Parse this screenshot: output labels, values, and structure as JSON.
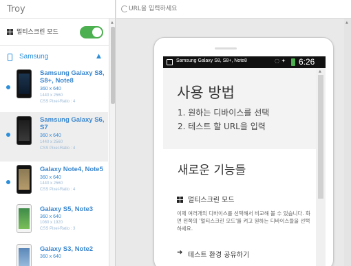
{
  "app": {
    "title": "Troy"
  },
  "multiscreen": {
    "label": "멀티스크린 모드",
    "enabled": true
  },
  "group": {
    "label": "Samsung",
    "expanded": true
  },
  "devices": [
    {
      "name": "Samsung Galaxy S8, S8+, Note8",
      "resolution": "360 x 640",
      "physical": "1440 x 2560",
      "ratio": "CSS Pixel-Ratio : 4",
      "dot": true,
      "selected": false
    },
    {
      "name": "Samsung Galaxy S6, S7",
      "resolution": "360 x 640",
      "physical": "1440 x 2560",
      "ratio": "CSS Pixel-Ratio : 4",
      "dot": true,
      "selected": true
    },
    {
      "name": "Galaxy Note4, Note5",
      "resolution": "360 x 640",
      "physical": "1440 x 2560",
      "ratio": "CSS Pixel-Ratio : 4",
      "dot": true,
      "selected": false
    },
    {
      "name": "Galaxy S5, Note3",
      "resolution": "360 x 640",
      "physical": "1080 x 1920",
      "ratio": "CSS Pixel-Ratio : 3",
      "dot": false,
      "selected": false
    },
    {
      "name": "Galaxy S3, Note2",
      "resolution": "360 x 640",
      "dot": false,
      "selected": false
    }
  ],
  "urlbar": {
    "placeholder": "URL을 입력하세요",
    "value": ""
  },
  "preview": {
    "status_title": "Samsung Galaxy S8, S8+, Note8",
    "status_time": "6:26",
    "hero_title": "사용 방법",
    "steps": [
      "1. 원하는 디바이스를 선택",
      "2. 테스트 할 URL을 입력"
    ],
    "section_title": "새로운 기능들",
    "feature_title": "멀티스크린 모드",
    "feature_desc": "이제 여러개의 디바이스를 선택해서 비교해 볼 수 있습니다. 화면 왼쪽의 '멀티스크린 모드'를 켜고 원하는 디바이스들을 선택하세요.",
    "share_title": "테스트 환경 공유하기"
  },
  "colors": {
    "accent": "#2d8fd9",
    "toggle_on": "#4caf50",
    "selected_bg": "#eeeeee"
  },
  "icons": [
    "grid-icon",
    "phone-icon",
    "chevron-up-icon",
    "reload-icon",
    "share-arrow-icon"
  ]
}
